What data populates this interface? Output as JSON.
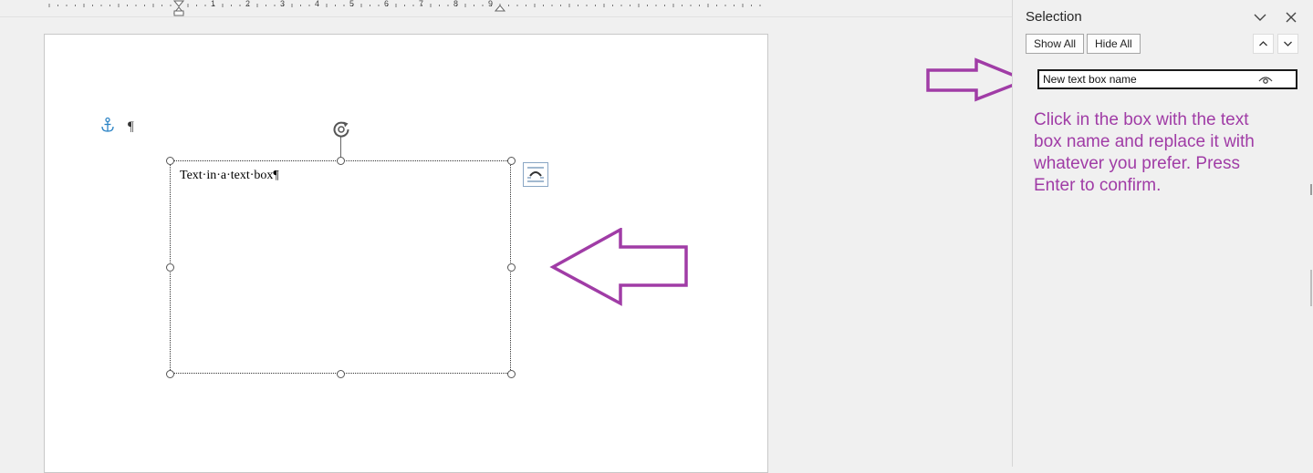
{
  "ruler": {
    "numbers": [
      "1",
      "2",
      "3",
      "4",
      "5",
      "6",
      "7",
      "8",
      "9"
    ]
  },
  "document": {
    "paragraph_mark": "¶",
    "textbox_text": "Text·in·a·text·box¶"
  },
  "selection_pane": {
    "title": "Selection",
    "show_all_label": "Show All",
    "hide_all_label": "Hide All",
    "shape_name": "New text box name",
    "instructions": "Click in the box with the text box name and replace it with whatever you prefer. Press Enter to confirm."
  },
  "colors": {
    "annotation_purple": "#a03ca6",
    "anchor_blue": "#2b83c5",
    "page_background": "#ffffff",
    "app_background": "#f0f0f0"
  },
  "icons": {
    "anchor": "anchor-icon",
    "rotate": "rotate-handle-icon",
    "layout": "layout-options-icon",
    "collapse": "chevron-down-icon",
    "close": "close-icon",
    "up": "chevron-up-icon",
    "down": "chevron-down-icon",
    "visibility": "eye-icon"
  }
}
